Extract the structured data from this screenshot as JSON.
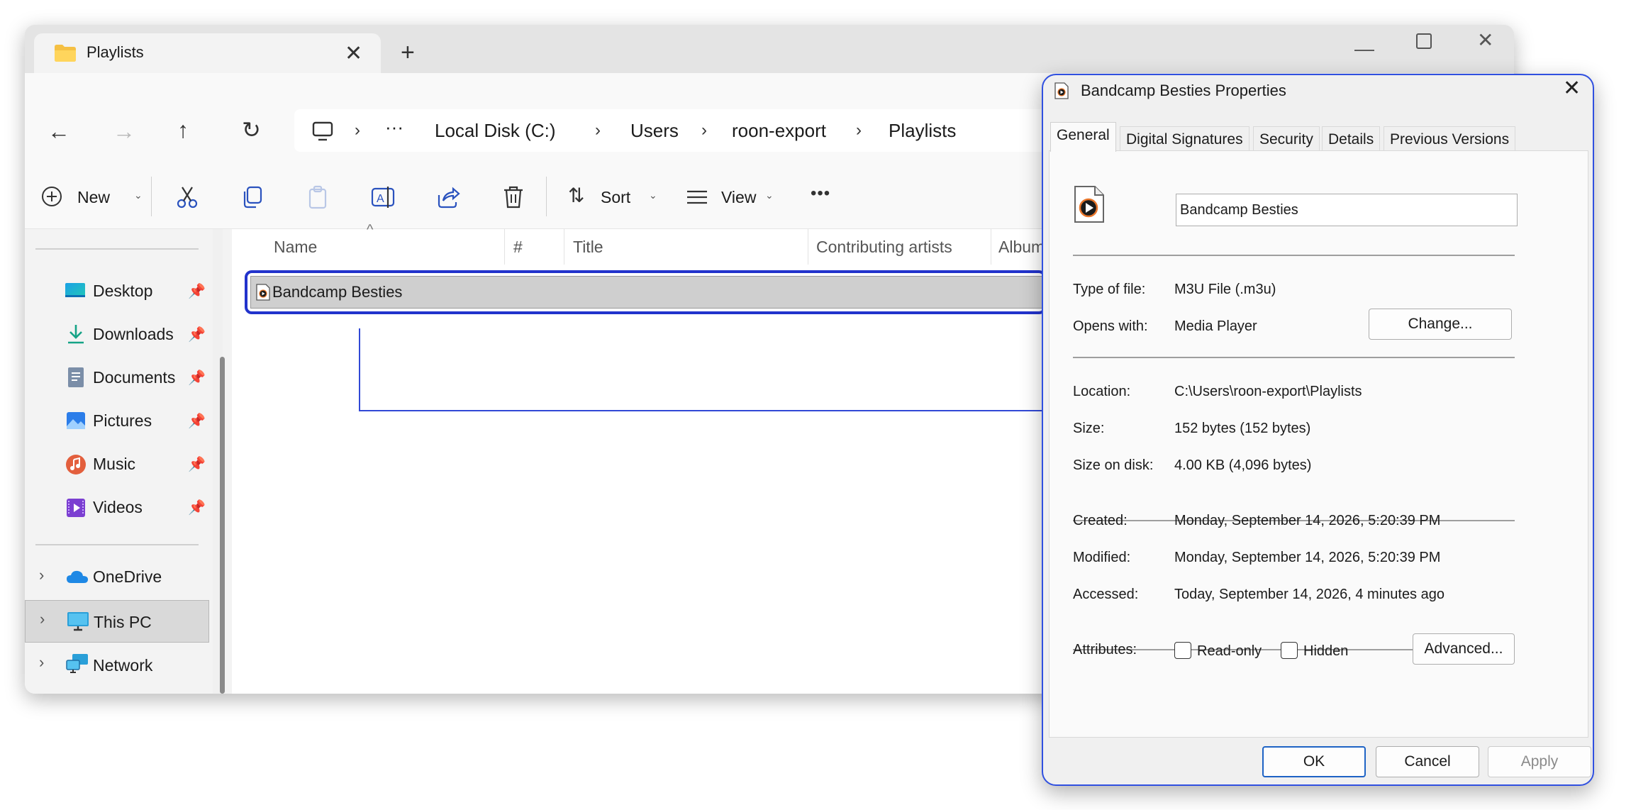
{
  "explorer": {
    "tab_title": "Playlists",
    "breadcrumb": [
      "Local Disk (C:)",
      "Users",
      "roon-export",
      "Playlists"
    ],
    "breadcrumb_more": "···",
    "toolbar": {
      "new_label": "New",
      "sort_label": "Sort",
      "view_label": "View",
      "more_label": "•••"
    },
    "sidebar": {
      "quick_access": [
        {
          "label": "Desktop"
        },
        {
          "label": "Downloads"
        },
        {
          "label": "Documents"
        },
        {
          "label": "Pictures"
        },
        {
          "label": "Music"
        },
        {
          "label": "Videos"
        }
      ],
      "locations": [
        {
          "label": "OneDrive"
        },
        {
          "label": "This PC"
        },
        {
          "label": "Network"
        }
      ]
    },
    "columns": [
      "Name",
      "#",
      "Title",
      "Contributing artists",
      "Album"
    ],
    "files": [
      {
        "name": "Bandcamp Besties"
      }
    ]
  },
  "dialog": {
    "title": "Bandcamp Besties Properties",
    "tabs": [
      "General",
      "Digital Signatures",
      "Security",
      "Details",
      "Previous Versions"
    ],
    "file_name": "Bandcamp Besties",
    "type_of_file_label": "Type of file:",
    "type_of_file": "M3U File (.m3u)",
    "opens_with_label": "Opens with:",
    "opens_with": "Media Player",
    "change_button": "Change...",
    "location_label": "Location:",
    "location": "C:\\Users\\roon-export\\Playlists",
    "size_label": "Size:",
    "size": "152 bytes (152 bytes)",
    "size_on_disk_label": "Size on disk:",
    "size_on_disk": "4.00 KB (4,096 bytes)",
    "created_label": "Created:",
    "created": "Monday, September 14, 2026, 5:20:39 PM",
    "modified_label": "Modified:",
    "modified": "Monday, September 14, 2026, 5:20:39 PM",
    "accessed_label": "Accessed:",
    "accessed": "Today, September 14, 2026, 4 minutes ago",
    "attributes_label": "Attributes:",
    "readonly_label": "Read-only",
    "hidden_label": "Hidden",
    "advanced_button": "Advanced...",
    "ok_button": "OK",
    "cancel_button": "Cancel",
    "apply_button": "Apply"
  },
  "colors": {
    "accent": "#0067c0",
    "selection_border": "#2233cc",
    "dialog_border": "#3050e0"
  }
}
